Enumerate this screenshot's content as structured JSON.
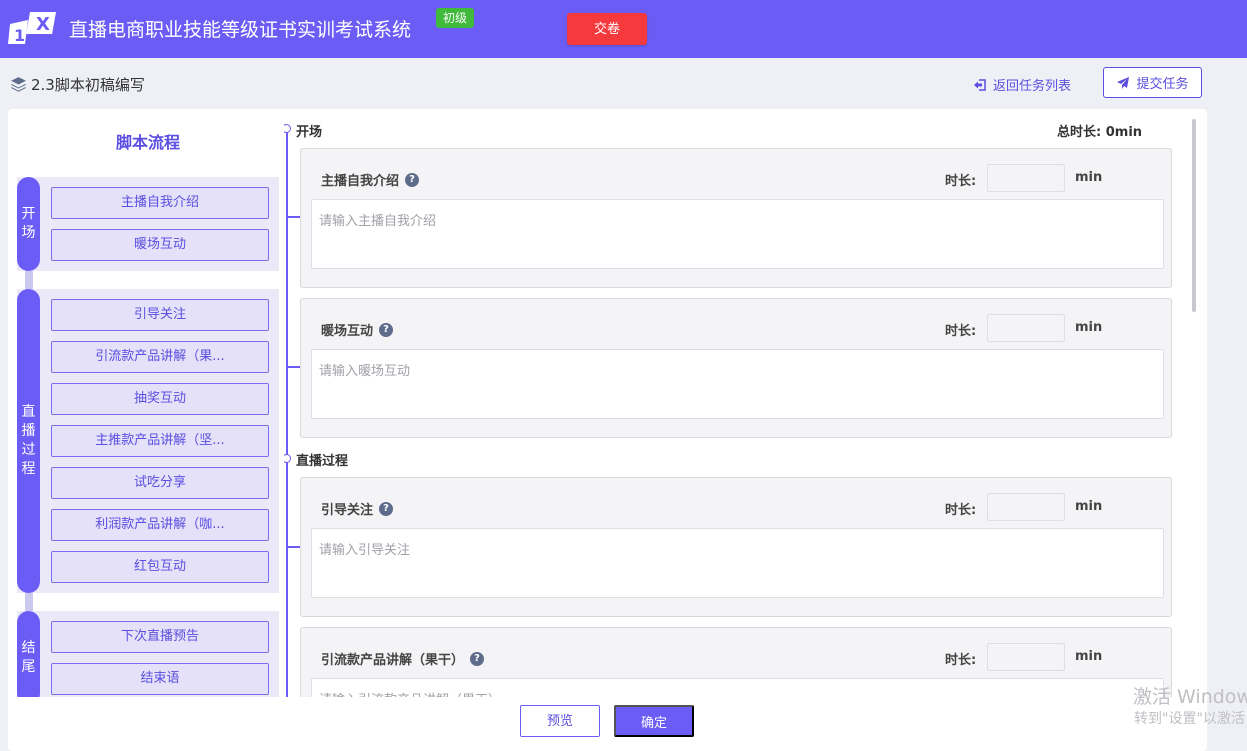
{
  "header": {
    "title": "直播电商职业技能等级证书实训考试系统",
    "level_badge": "初级",
    "submit_exam_label": "交卷",
    "accent_color": "#6c5cf6",
    "danger_color": "#f5393d",
    "logo_text": "1+X"
  },
  "breadcrumb": {
    "icon": "layers-icon",
    "text": "2.3脚本初稿编写"
  },
  "actions": {
    "back_label": "返回任务列表",
    "back_icon": "sign-out-icon",
    "submit_task_label": "提交任务",
    "submit_task_icon": "paper-plane-icon"
  },
  "flow": {
    "title": "脚本流程",
    "groups": [
      {
        "label_chars": [
          "开",
          "场"
        ],
        "items": [
          "主播自我介绍",
          "暖场互动"
        ]
      },
      {
        "label_chars": [
          "直",
          "播",
          "过",
          "程"
        ],
        "items": [
          "引导关注",
          "引流款产品讲解（果...",
          "抽奖互动",
          "主推款产品讲解（坚...",
          "试吃分享",
          "利润款产品讲解（咖...",
          "红包互动"
        ]
      },
      {
        "label_chars": [
          "结",
          "尾"
        ],
        "items": [
          "下次直播预告",
          "结束语"
        ]
      }
    ]
  },
  "editor": {
    "total_label": "总时长:",
    "total_value": "0min",
    "duration_label": "时长:",
    "unit": "min",
    "sections": [
      {
        "name": "开场",
        "cards": [
          {
            "title": "主播自我介绍",
            "placeholder": "请输入主播自我介绍",
            "duration": ""
          },
          {
            "title": "暖场互动",
            "placeholder": "请输入暖场互动",
            "duration": ""
          }
        ]
      },
      {
        "name": "直播过程",
        "cards": [
          {
            "title": "引导关注",
            "placeholder": "请输入引导关注",
            "duration": ""
          },
          {
            "title": "引流款产品讲解（果干）",
            "placeholder": "请输入引流款产品讲解（果干）",
            "duration": ""
          }
        ]
      }
    ]
  },
  "footer": {
    "preview_label": "预览",
    "confirm_label": "确定"
  },
  "watermark": {
    "line1": "激活 Window",
    "line2": "转到\"设置\"以激活"
  }
}
